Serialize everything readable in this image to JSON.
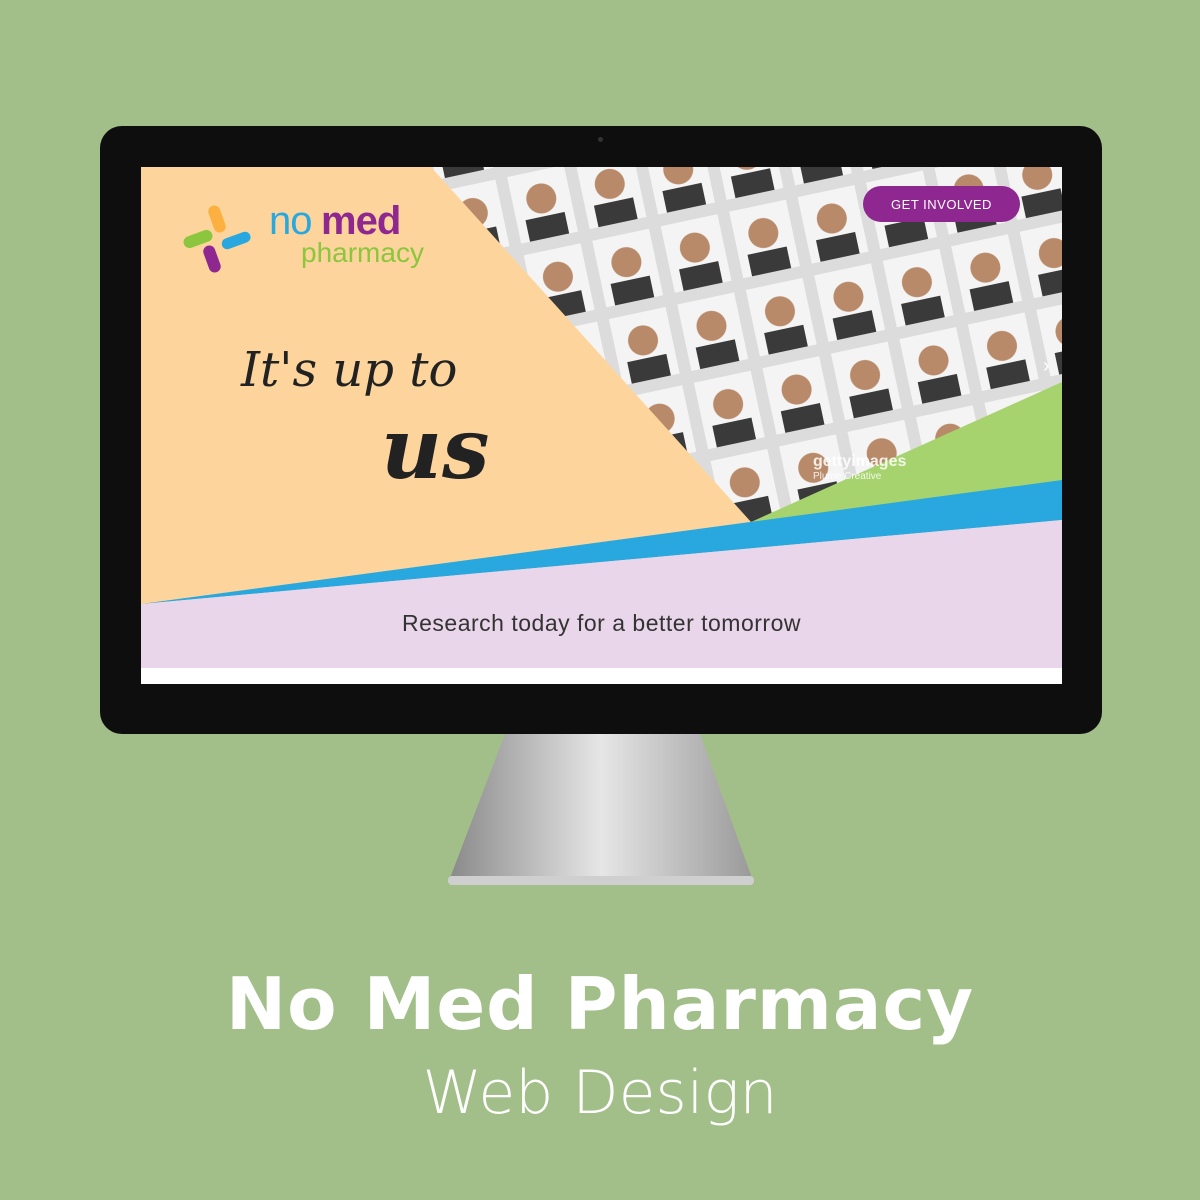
{
  "site": {
    "logo": {
      "no": "no",
      "med": "med",
      "pharmacy": "pharmacy"
    },
    "cta_label": "GET INVOLVED",
    "tagline_line1": "It's up to",
    "tagline_line2": "us",
    "subtitle": "Research today for a better tomorrow",
    "watermark": {
      "brand": "gettyimages",
      "credit": "Plume Creative"
    },
    "next_arrow": "›"
  },
  "caption": {
    "title": "No Med Pharmacy",
    "subtitle": "Web Design"
  },
  "colors": {
    "background": "#a2bf89",
    "peach": "#fdd59c",
    "purple": "#8e278f",
    "blue": "#29a8e0",
    "green": "#8cc63f",
    "pink": "#ead6ea"
  }
}
